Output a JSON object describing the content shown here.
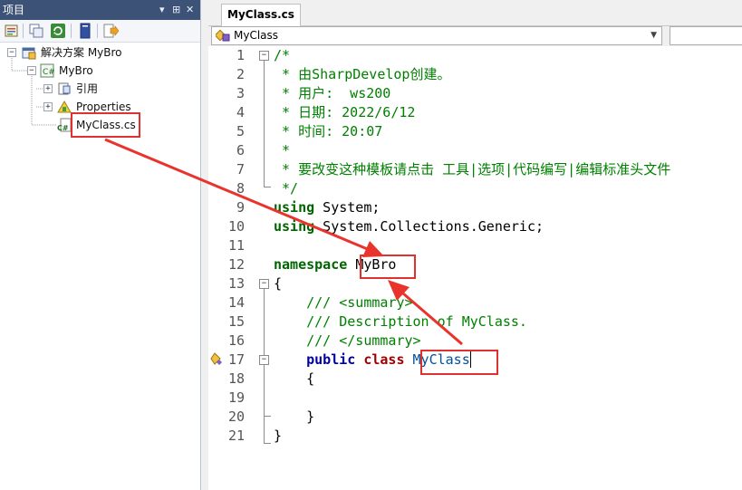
{
  "project_panel": {
    "title": "项目",
    "pin_glyph": "▾ ⊞ ✕"
  },
  "toolbar": {
    "icons": [
      "properties-icon",
      "collapse-icon",
      "refresh-icon",
      "show-all-icon",
      "view-code-icon"
    ]
  },
  "tree": {
    "solution": "解决方案 MyBro",
    "project": "MyBro",
    "references": "引用",
    "properties": "Properties",
    "file": "MyClass.cs"
  },
  "editor": {
    "tab_label": "MyClass.cs",
    "class_combo": "MyClass",
    "line_numbers": [
      "1",
      "2",
      "3",
      "4",
      "5",
      "6",
      "7",
      "8",
      "9",
      "10",
      "11",
      "12",
      "13",
      "14",
      "15",
      "16",
      "17",
      "18",
      "19",
      "20",
      "21"
    ]
  },
  "code": {
    "l1": "/*",
    "l2": " * 由SharpDevelop创建。",
    "l3": " * 用户:  ws200",
    "l4": " * 日期: 2022/6/12",
    "l5": " * 时间: 20:07",
    "l6": " *",
    "l7": " * 要改变这种模板请点击 工具|选项|代码编写|编辑标准头文件",
    "l8": " */",
    "l9_kw": "using",
    "l9_rest": " System;",
    "l10_kw": "using",
    "l10_rest": " System.Collections.Generic;",
    "l12_kw": "namespace",
    "l12_name": "MyBro",
    "l13": "{",
    "l14": "    /// <summary>",
    "l15": "    /// Description of MyClass.",
    "l16": "    /// </summary>",
    "l17_public": "public",
    "l17_class": "class",
    "l17_name": "MyClass",
    "l18": "    {",
    "l20": "    }",
    "l21": "}"
  },
  "colors": {
    "panel_title_bg": "#3d5277",
    "comment": "#008000",
    "highlight_box": "#e03030",
    "arrow": "#e8342c"
  }
}
